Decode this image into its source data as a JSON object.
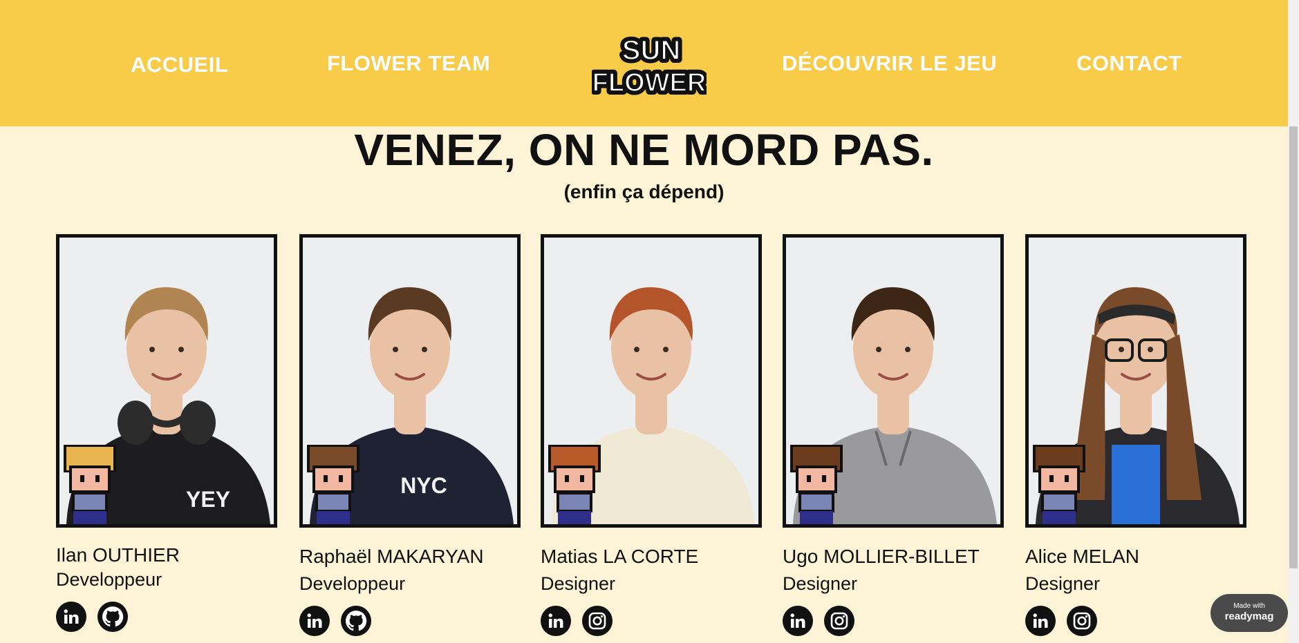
{
  "nav": {
    "home": "ACCUEIL",
    "team": "FLOWER TEAM",
    "game": "DÉCOUVRIR LE JEU",
    "contact": "CONTACT",
    "logo_line1": "SUN",
    "logo_line2": "FLOWER"
  },
  "heading": {
    "title": "VENEZ, ON NE MORD PAS.",
    "subtitle": "(enfin ça dépend)"
  },
  "team": [
    {
      "name": "Ilan OUTHIER",
      "role": "Developpeur",
      "shirt_text": "YEY",
      "socials": [
        "linkedin-icon",
        "github-icon"
      ],
      "hair": "#b08552",
      "shirt": "#1d1d1f",
      "sprite_hair": "#e8b551"
    },
    {
      "name": "Raphaël MAKARYAN",
      "role": "Developpeur",
      "shirt_text": "NYC",
      "socials": [
        "linkedin-icon",
        "github-icon"
      ],
      "hair": "#5a3a23",
      "shirt": "#1e2233",
      "sprite_hair": "#7a4b2a"
    },
    {
      "name": "Matias LA CORTE",
      "role": "Designer",
      "shirt_text": "",
      "socials": [
        "linkedin-icon",
        "instagram-icon"
      ],
      "hair": "#b4542a",
      "shirt": "#efe9d6",
      "sprite_hair": "#b85a2a"
    },
    {
      "name": "Ugo MOLLIER-BILLET",
      "role": "Designer",
      "shirt_text": "",
      "socials": [
        "linkedin-icon",
        "instagram-icon"
      ],
      "hair": "#3d2616",
      "shirt": "#9a9a9c",
      "sprite_hair": "#6b3d1e"
    },
    {
      "name": "Alice MELAN",
      "role": "Designer",
      "shirt_text": "",
      "socials": [
        "linkedin-icon",
        "instagram-icon"
      ],
      "hair": "#7a4b2b",
      "shirt": "#2a2a2e",
      "sprite_hair": "#6b3d1e"
    }
  ],
  "badge": {
    "made_with": "Made with",
    "brand": "readymag"
  },
  "colors": {
    "header_bg": "#f8cc49",
    "page_bg": "#fdf3d6",
    "text": "#111111"
  }
}
